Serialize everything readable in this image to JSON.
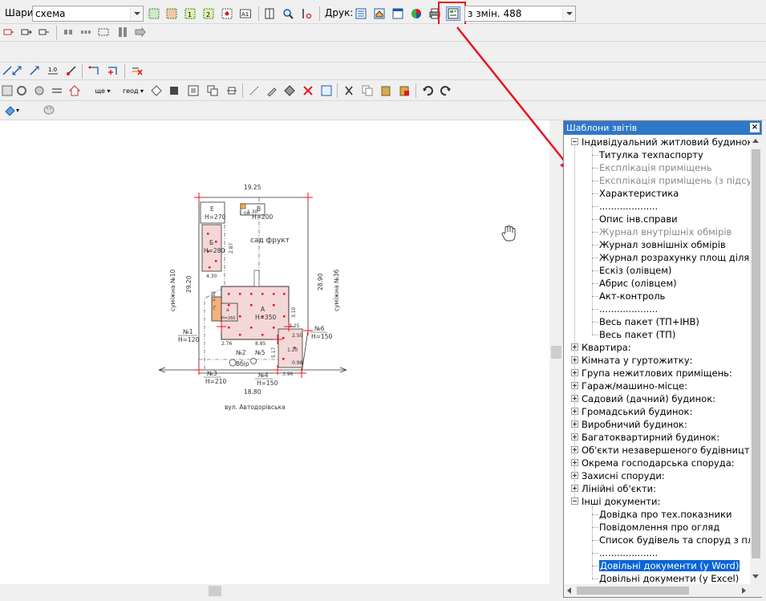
{
  "layers": {
    "label": "Шари:",
    "value": "схема"
  },
  "print": {
    "label": "Друк:"
  },
  "changes": {
    "value": "з змін. 488"
  },
  "panel": {
    "title": "Шаблони звітів",
    "tree": [
      {
        "label": "Індивідуальний житловий будинок",
        "level": 0,
        "expander": "minus",
        "disabled": false,
        "selected": false
      },
      {
        "label": "Титулка техпаспорту",
        "level": 1,
        "expander": null,
        "disabled": false,
        "selected": false
      },
      {
        "label": "Експлікація приміщень",
        "level": 1,
        "expander": null,
        "disabled": true,
        "selected": false
      },
      {
        "label": "Експлікація приміщень (з підсумками)",
        "level": 1,
        "expander": null,
        "disabled": true,
        "selected": false
      },
      {
        "label": "Характеристика",
        "level": 1,
        "expander": null,
        "disabled": false,
        "selected": false
      },
      {
        "label": "....................",
        "level": 1,
        "expander": null,
        "disabled": false,
        "selected": false
      },
      {
        "label": "Опис інв.справи",
        "level": 1,
        "expander": null,
        "disabled": false,
        "selected": false
      },
      {
        "label": "Журнал внутрішніх обмірів",
        "level": 1,
        "expander": null,
        "disabled": true,
        "selected": false
      },
      {
        "label": "Журнал зовнішніх обмірів",
        "level": 1,
        "expander": null,
        "disabled": false,
        "selected": false
      },
      {
        "label": "Журнал розрахунку площ ділянки",
        "level": 1,
        "expander": null,
        "disabled": false,
        "selected": false
      },
      {
        "label": "Ескіз (олівцем)",
        "level": 1,
        "expander": null,
        "disabled": false,
        "selected": false
      },
      {
        "label": "Абрис (олівцем)",
        "level": 1,
        "expander": null,
        "disabled": false,
        "selected": false
      },
      {
        "label": "Акт-контроль",
        "level": 1,
        "expander": null,
        "disabled": false,
        "selected": false
      },
      {
        "label": "....................",
        "level": 1,
        "expander": null,
        "disabled": false,
        "selected": false
      },
      {
        "label": "Весь пакет (ТП+ІНВ)",
        "level": 1,
        "expander": null,
        "disabled": false,
        "selected": false
      },
      {
        "label": "Весь пакет (ТП)",
        "level": 1,
        "expander": null,
        "disabled": false,
        "selected": false
      },
      {
        "label": "Квартира:",
        "level": 0,
        "expander": "plus",
        "disabled": false,
        "selected": false
      },
      {
        "label": "Кімната у гуртожитку:",
        "level": 0,
        "expander": "plus",
        "disabled": false,
        "selected": false
      },
      {
        "label": "Група нежитлових приміщень:",
        "level": 0,
        "expander": "plus",
        "disabled": false,
        "selected": false
      },
      {
        "label": "Гараж/машино-місце:",
        "level": 0,
        "expander": "plus",
        "disabled": false,
        "selected": false
      },
      {
        "label": "Садовий (дачний) будинок:",
        "level": 0,
        "expander": "plus",
        "disabled": false,
        "selected": false
      },
      {
        "label": "Громадський будинок:",
        "level": 0,
        "expander": "plus",
        "disabled": false,
        "selected": false
      },
      {
        "label": "Виробничий будинок:",
        "level": 0,
        "expander": "plus",
        "disabled": false,
        "selected": false
      },
      {
        "label": "Багатоквартирний будинок:",
        "level": 0,
        "expander": "plus",
        "disabled": false,
        "selected": false
      },
      {
        "label": "Об'єкти незавершеного будівництва:",
        "level": 0,
        "expander": "plus",
        "disabled": false,
        "selected": false
      },
      {
        "label": "Окрема господарська споруда:",
        "level": 0,
        "expander": "plus",
        "disabled": false,
        "selected": false
      },
      {
        "label": "Захисні споруди:",
        "level": 0,
        "expander": "plus",
        "disabled": false,
        "selected": false
      },
      {
        "label": "Лінійні об'єкти:",
        "level": 0,
        "expander": "plus",
        "disabled": false,
        "selected": false
      },
      {
        "label": "Інші документи:",
        "level": 0,
        "expander": "minus",
        "disabled": false,
        "selected": false
      },
      {
        "label": "Довідка про тех.показники",
        "level": 1,
        "expander": null,
        "disabled": false,
        "selected": false
      },
      {
        "label": "Повідомлення про огляд",
        "level": 1,
        "expander": null,
        "disabled": false,
        "selected": false
      },
      {
        "label": "Список будівель та споруд з площами",
        "level": 1,
        "expander": null,
        "disabled": false,
        "selected": false
      },
      {
        "label": "....................",
        "level": 1,
        "expander": null,
        "disabled": false,
        "selected": false
      },
      {
        "label": "Довільні документи (у Word)",
        "level": 1,
        "expander": null,
        "disabled": false,
        "selected": true
      },
      {
        "label": "Довільні документи (у Excel)",
        "level": 1,
        "expander": null,
        "disabled": false,
        "selected": false
      }
    ]
  },
  "drawing": {
    "top_width": "19.25",
    "bottom_width": "18.80",
    "left_height": "29.20",
    "right_height": "28.90",
    "street": "вул. Автодорівська",
    "left_neighbor": "суміжна №10",
    "right_neighbor": "суміжна №36",
    "garden": "сад фрукт",
    "bldg_a": "А",
    "bldg_a_h": "Н=350",
    "bldg_b": "Б",
    "bldg_b_h": "Н=280",
    "bldg_v": "В",
    "bldg_v_h": "Н=200",
    "bldg_e": "Е",
    "bldg_e_h": "Н=270",
    "bldg_g": "Г",
    "bldg_g_h": "Н=260",
    "bldg_a1": "а",
    "pt1": "№1",
    "pt1_h": "Н=120",
    "pt2": "№2",
    "pt3": "№3",
    "pt3_h": "Н=210",
    "pt4": "№4",
    "pt4_h": "Н=150",
    "pt5": "№5",
    "pt6": "№6",
    "pt6_h": "Н=150",
    "well": "Вбір",
    "dim_885": "8.85",
    "dim_276": "2.76",
    "dim_130": "1.30",
    "dim_100": "1.00",
    "dim_430": "4.30",
    "dim_287": "2.87",
    "dim_396": "3.96",
    "dim_250": "2.50",
    "dim_517": "5.17",
    "dim_325": "3.25",
    "dim_135": "1.35",
    "dim_310": "3.10",
    "dim_120": "1.20",
    "dim_98": "0.98"
  },
  "colors": {
    "annotation_red": "#e8141c",
    "selection_blue": "#0a64d6",
    "panel_title": "#2f77c7"
  }
}
